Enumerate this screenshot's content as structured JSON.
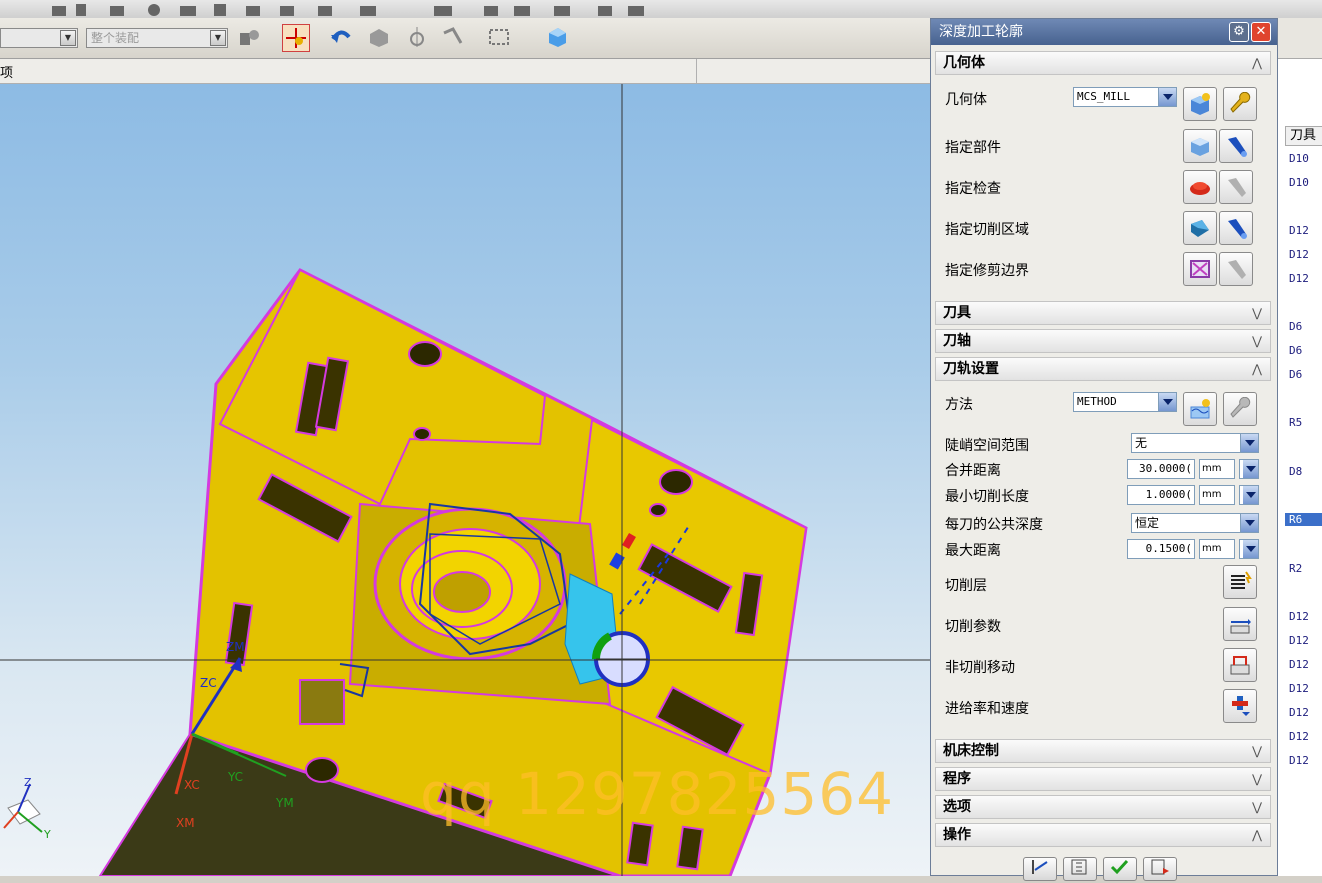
{
  "toolbar": {
    "filter_combo": "",
    "assembly_combo": "整个装配"
  },
  "header": {
    "left_label": "项"
  },
  "dialog": {
    "title": "深度加工轮廓",
    "sections": {
      "geometry": {
        "header": "几何体",
        "geometry_label": "几何体",
        "geometry_value": "MCS_MILL",
        "part_label": "指定部件",
        "check_label": "指定检查",
        "cut_area_label": "指定切削区域",
        "trim_boundary_label": "指定修剪边界"
      },
      "tool": {
        "header": "刀具"
      },
      "axis": {
        "header": "刀轴"
      },
      "path": {
        "header": "刀轨设置",
        "method_label": "方法",
        "method_value": "METHOD",
        "steep_label": "陡峭空间范围",
        "steep_value": "无",
        "merge_label": "合并距离",
        "merge_value": "30.0000(",
        "merge_unit": "mm",
        "min_cut_label": "最小切削长度",
        "min_cut_value": "1.0000(",
        "min_cut_unit": "mm",
        "depth_label": "每刀的公共深度",
        "depth_value": "恒定",
        "max_dist_label": "最大距离",
        "max_dist_value": "0.1500(",
        "max_dist_unit": "mm",
        "cut_levels_label": "切削层",
        "cut_params_label": "切削参数",
        "non_cut_label": "非切削移动",
        "feeds_label": "进给率和速度"
      },
      "machine": {
        "header": "机床控制"
      },
      "program": {
        "header": "程序"
      },
      "options": {
        "header": "选项"
      },
      "actions": {
        "header": "操作"
      }
    }
  },
  "navigator": {
    "column_header": "刀具",
    "rows": [
      "D10",
      "D10",
      "D12",
      "D12",
      "D12",
      "D6",
      "D6",
      "D6",
      "R5",
      "D8",
      "R6",
      "R2",
      "D12",
      "D12",
      "D12",
      "D12",
      "D12",
      "D12",
      "D12"
    ]
  },
  "viewport": {
    "watermark": "qq 1297825564",
    "triad": {
      "zm": "ZM",
      "zc": "ZC",
      "xc": "XC",
      "xm": "XM",
      "yc": "YC",
      "ym": "YM"
    },
    "mini_triad": {
      "z": "Z",
      "y": "Y"
    }
  },
  "colors": {
    "part": "#e3c200",
    "edges": "#d43ae0",
    "title_bar": "#5a77a6"
  }
}
